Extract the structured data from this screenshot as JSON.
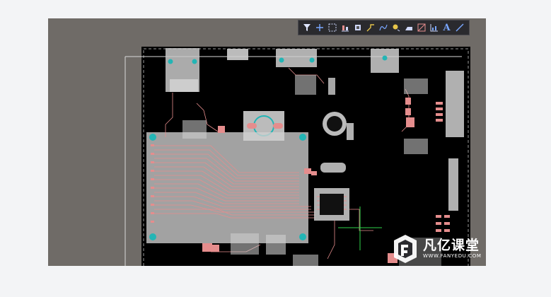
{
  "toolbar": {
    "tools": [
      {
        "name": "filter-tool-icon"
      },
      {
        "name": "cross-tool-icon"
      },
      {
        "name": "select-rect-tool-icon"
      },
      {
        "name": "align-tool-icon"
      },
      {
        "name": "component-tool-icon"
      },
      {
        "name": "route-tool-icon"
      },
      {
        "name": "diff-pair-tool-icon"
      },
      {
        "name": "pad-tool-icon"
      },
      {
        "name": "polygon-tool-icon"
      },
      {
        "name": "region-tool-icon"
      },
      {
        "name": "chart-tool-icon"
      },
      {
        "name": "text-tool-icon"
      },
      {
        "name": "line-tool-icon"
      }
    ],
    "text_tool_label": "A"
  },
  "colors": {
    "workspace": "#6f6b67",
    "board": "#000000",
    "copper": "#e58d8d",
    "overlay": "#cfcfcf",
    "cursor": "#2fd24a",
    "toolbar_icon": "#7aa7ff"
  },
  "watermark": {
    "brand": "凡亿课堂",
    "url": "WWW.FANYEDU.COM"
  }
}
